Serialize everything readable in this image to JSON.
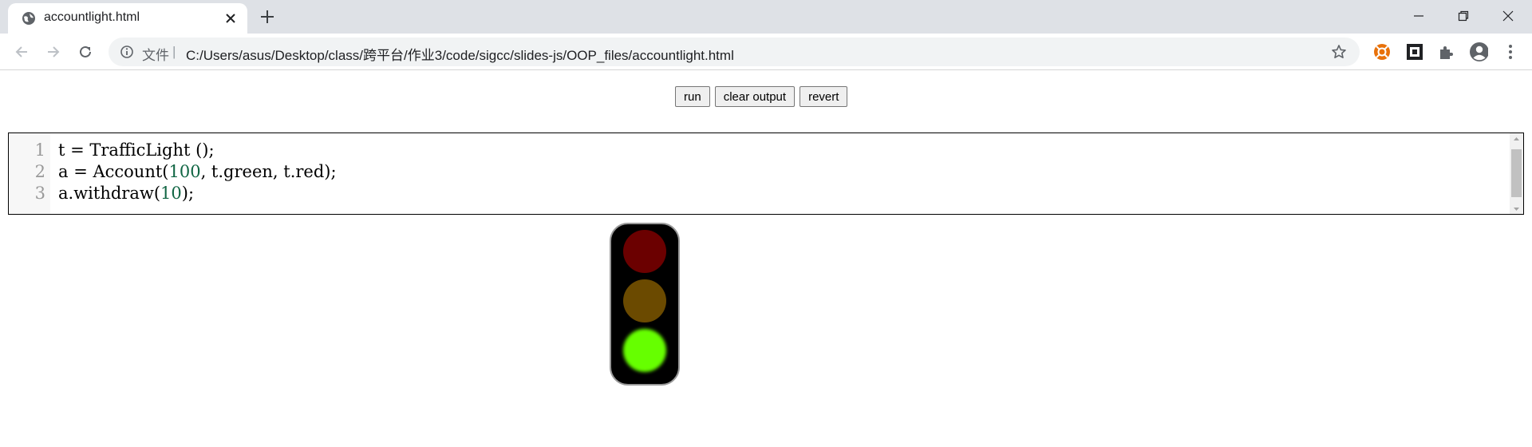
{
  "browser": {
    "tab_title": "accountlight.html",
    "address_label": "文件",
    "address_separator": "|",
    "url": "C:/Users/asus/Desktop/class/跨平台/作业3/code/sigcc/slides-js/OOP_files/accountlight.html"
  },
  "controls": {
    "run_label": "run",
    "clear_label": "clear output",
    "revert_label": "revert"
  },
  "editor": {
    "lines": [
      {
        "number": "1",
        "text": "t = TrafficLight ();"
      },
      {
        "number": "2",
        "before": "a = Account(",
        "num": "100",
        "after": ", t.green, t.red);"
      },
      {
        "number": "3",
        "before": "a.withdraw(",
        "num": "10",
        "after": ");"
      }
    ]
  },
  "traffic_light": {
    "lights": [
      {
        "name": "red",
        "state": "off",
        "color": "#6b0000"
      },
      {
        "name": "yellow",
        "state": "off",
        "color": "#6b4a00"
      },
      {
        "name": "green",
        "state": "on",
        "color": "#66ff00"
      }
    ]
  },
  "colors": {
    "number_literal": "#116644",
    "tabstrip": "#dee1e6",
    "extension_orange": "#e8710a"
  }
}
